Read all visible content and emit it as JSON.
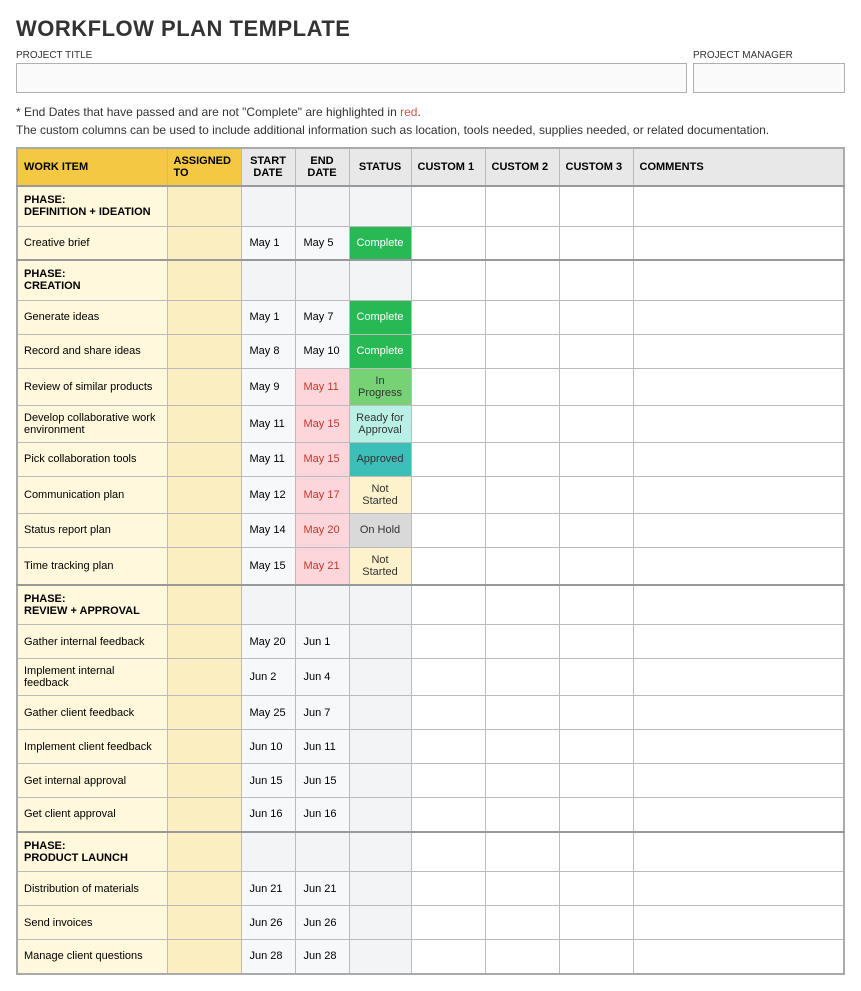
{
  "title": "WORKFLOW PLAN TEMPLATE",
  "form": {
    "project_title_label": "PROJECT TITLE",
    "project_manager_label": "PROJECT MANAGER"
  },
  "notes": {
    "line1a": "* End Dates that have passed and are not \"Complete\" are highlighted in ",
    "line1b": "red",
    "line1c": ".",
    "line2": "The custom columns can be used to include additional information such as location, tools needed, supplies needed, or related documentation."
  },
  "headers": {
    "work_item": "WORK ITEM",
    "assigned_to": "ASSIGNED TO",
    "start_date": "START DATE",
    "end_date": "END DATE",
    "status": "STATUS",
    "custom1": "CUSTOM 1",
    "custom2": "CUSTOM 2",
    "custom3": "CUSTOM 3",
    "comments": "COMMENTS"
  },
  "rows": [
    {
      "type": "phase",
      "label1": "PHASE:",
      "label2": "DEFINITION + IDEATION"
    },
    {
      "type": "item",
      "work": "Creative brief",
      "start": "May 1",
      "end": "May 5",
      "status": "Complete",
      "overdue": false
    },
    {
      "type": "phase",
      "label1": "PHASE:",
      "label2": "CREATION"
    },
    {
      "type": "item",
      "work": "Generate ideas",
      "start": "May 1",
      "end": "May 7",
      "status": "Complete",
      "overdue": false
    },
    {
      "type": "item",
      "work": "Record and share ideas",
      "start": "May 8",
      "end": "May 10",
      "status": "Complete",
      "overdue": false
    },
    {
      "type": "item",
      "work": "Review of similar products",
      "start": "May 9",
      "end": "May 11",
      "status": "In Progress",
      "overdue": true
    },
    {
      "type": "item",
      "work": "Develop collaborative work environment",
      "start": "May 11",
      "end": "May 15",
      "status": "Ready for Approval",
      "overdue": true
    },
    {
      "type": "item",
      "work": "Pick collaboration tools",
      "start": "May 11",
      "end": "May 15",
      "status": "Approved",
      "overdue": true
    },
    {
      "type": "item",
      "work": "Communication plan",
      "start": "May 12",
      "end": "May 17",
      "status": "Not Started",
      "overdue": true
    },
    {
      "type": "item",
      "work": "Status report plan",
      "start": "May 14",
      "end": "May 20",
      "status": "On Hold",
      "overdue": true
    },
    {
      "type": "item",
      "work": "Time tracking plan",
      "start": "May 15",
      "end": "May 21",
      "status": "Not Started",
      "overdue": true
    },
    {
      "type": "phase",
      "label1": "PHASE:",
      "label2": "REVIEW + APPROVAL"
    },
    {
      "type": "item",
      "work": "Gather internal feedback",
      "start": "May 20",
      "end": "Jun 1",
      "status": "",
      "overdue": false
    },
    {
      "type": "item",
      "work": "Implement internal feedback",
      "start": "Jun 2",
      "end": "Jun 4",
      "status": "",
      "overdue": false
    },
    {
      "type": "item",
      "work": "Gather client feedback",
      "start": "May 25",
      "end": "Jun 7",
      "status": "",
      "overdue": false
    },
    {
      "type": "item",
      "work": "Implement client feedback",
      "start": "Jun 10",
      "end": "Jun 11",
      "status": "",
      "overdue": false
    },
    {
      "type": "item",
      "work": "Get internal approval",
      "start": "Jun 15",
      "end": "Jun 15",
      "status": "",
      "overdue": false
    },
    {
      "type": "item",
      "work": "Get client approval",
      "start": "Jun 16",
      "end": "Jun 16",
      "status": "",
      "overdue": false
    },
    {
      "type": "phase",
      "label1": "PHASE:",
      "label2": "PRODUCT LAUNCH"
    },
    {
      "type": "item",
      "work": "Distribution of materials",
      "start": "Jun 21",
      "end": "Jun 21",
      "status": "",
      "overdue": false
    },
    {
      "type": "item",
      "work": "Send invoices",
      "start": "Jun 26",
      "end": "Jun 26",
      "status": "",
      "overdue": false
    },
    {
      "type": "item",
      "work": "Manage client questions",
      "start": "Jun 28",
      "end": "Jun 28",
      "status": "",
      "overdue": false
    }
  ]
}
